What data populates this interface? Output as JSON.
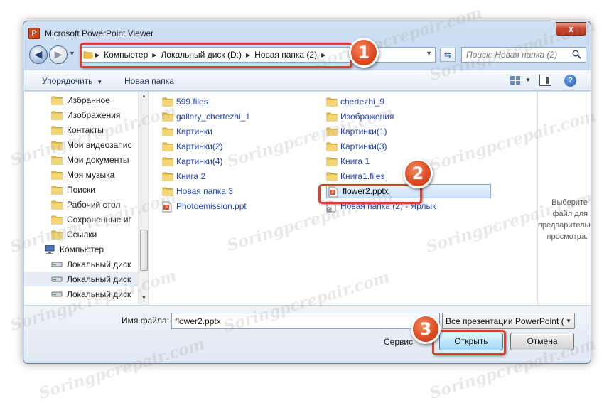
{
  "window": {
    "title": "Microsoft PowerPoint Viewer",
    "close_glyph": "x",
    "app_icon_letter": "P"
  },
  "nav": {
    "back_glyph": "◀",
    "breadcrumb": [
      "Компьютер",
      "Локальный диск (D:)",
      "Новая папка (2)"
    ],
    "search_placeholder": "Поиск: Новая папка (2)"
  },
  "toolbar": {
    "organize_label": "Упорядочить",
    "new_folder_label": "Новая папка"
  },
  "sidebar": {
    "items": [
      {
        "label": "Избранное",
        "icon": "star-folder-icon"
      },
      {
        "label": "Изображения",
        "icon": "folder-icon"
      },
      {
        "label": "Контакты",
        "icon": "folder-icon"
      },
      {
        "label": "Мои видеозапис",
        "icon": "folder-icon"
      },
      {
        "label": "Мои документы",
        "icon": "folder-icon"
      },
      {
        "label": "Моя музыка",
        "icon": "folder-icon"
      },
      {
        "label": "Поиски",
        "icon": "folder-icon"
      },
      {
        "label": "Рабочий стол",
        "icon": "folder-icon"
      },
      {
        "label": "Сохраненные иг",
        "icon": "folder-icon"
      },
      {
        "label": "Ссылки",
        "icon": "folder-icon"
      },
      {
        "label": "Компьютер",
        "icon": "computer-icon"
      },
      {
        "label": "Локальный диск",
        "icon": "drive-icon"
      },
      {
        "label": "Локальный диск",
        "icon": "drive-icon"
      },
      {
        "label": "Локальный диск",
        "icon": "drive-icon"
      }
    ]
  },
  "files": {
    "col1": [
      {
        "name": "599.files",
        "icon": "folder-icon"
      },
      {
        "name": "gallery_chertezhi_1",
        "icon": "folder-icon"
      },
      {
        "name": "Картинки",
        "icon": "folder-icon"
      },
      {
        "name": "Картинки(2)",
        "icon": "folder-icon"
      },
      {
        "name": "Картинки(4)",
        "icon": "folder-icon"
      },
      {
        "name": "Книга 2",
        "icon": "folder-icon"
      },
      {
        "name": "Новая папка 3",
        "icon": "folder-icon"
      },
      {
        "name": "Photoemission.ppt",
        "icon": "ppt-file-icon"
      }
    ],
    "col2": [
      {
        "name": "chertezhi_9",
        "icon": "folder-icon"
      },
      {
        "name": "Изображения",
        "icon": "folder-icon"
      },
      {
        "name": "Картинки(1)",
        "icon": "folder-icon"
      },
      {
        "name": "Картинки(3)",
        "icon": "folder-icon"
      },
      {
        "name": "Книга 1",
        "icon": "folder-icon"
      },
      {
        "name": "Книга1.files",
        "icon": "folder-icon"
      },
      {
        "name": "flower2.pptx",
        "icon": "pptx-file-icon"
      },
      {
        "name": "Новая папка (2) - Ярлык",
        "icon": "shortcut-icon"
      }
    ]
  },
  "preview": {
    "text": "Выберите файл для предварительного просмотра."
  },
  "bottom": {
    "filename_label": "Имя файла:",
    "filename_value": "flower2.pptx",
    "filetype_value": "Все презентации PowerPoint (",
    "service_label": "Сервис",
    "open_label": "Открыть",
    "cancel_label": "Отмена"
  },
  "callouts": {
    "step1": "1",
    "step2": "2",
    "step3": "3"
  },
  "watermark": "Soringpcrepair.com",
  "colors": {
    "accent": "#1f3fbb",
    "callout": "#d9402c",
    "selection": "#cbe1f9"
  }
}
